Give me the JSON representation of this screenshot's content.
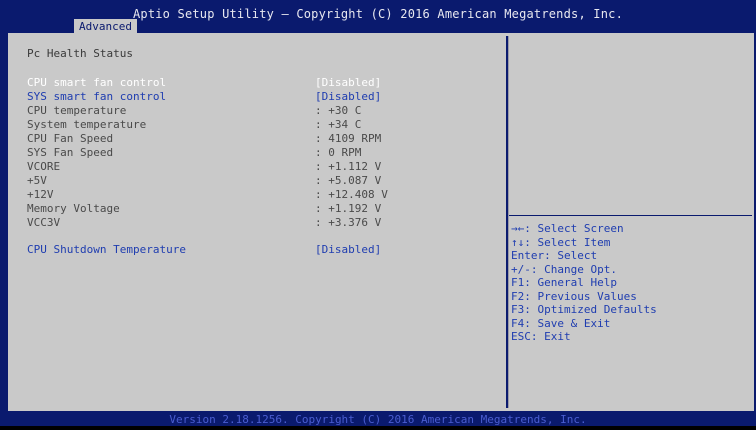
{
  "header": {
    "title": "Aptio Setup Utility – Copyright (C) 2016 American Megatrends, Inc.",
    "tab": "Advanced"
  },
  "main": {
    "heading": "Pc Health Status",
    "rows": [
      {
        "label": "CPU smart fan control",
        "value": "[Disabled]"
      },
      {
        "label": "SYS smart fan control",
        "value": "[Disabled]"
      },
      {
        "label": "CPU temperature",
        "value": ": +30 C"
      },
      {
        "label": "System temperature",
        "value": ": +34 C"
      },
      {
        "label": "CPU Fan Speed",
        "value": ": 4109 RPM"
      },
      {
        "label": "SYS Fan Speed",
        "value": ": 0 RPM"
      },
      {
        "label": "VCORE",
        "value": ": +1.112 V"
      },
      {
        "label": "+5V",
        "value": ": +5.087 V"
      },
      {
        "label": "+12V",
        "value": ": +12.408 V"
      },
      {
        "label": "Memory Voltage",
        "value": ": +1.192 V"
      },
      {
        "label": "VCC3V",
        "value": ": +3.376 V"
      }
    ],
    "shutdown": {
      "label": "CPU Shutdown Temperature",
      "value": "[Disabled]"
    }
  },
  "help": {
    "lines": [
      "→←: Select Screen",
      "↑↓: Select Item",
      "Enter: Select",
      "+/-: Change Opt.",
      "F1: General Help",
      "F2: Previous Values",
      "F3: Optimized Defaults",
      "F4: Save & Exit",
      "ESC: Exit"
    ]
  },
  "footer": {
    "text": "Version 2.18.1256. Copyright (C) 2016 American Megatrends, Inc."
  }
}
